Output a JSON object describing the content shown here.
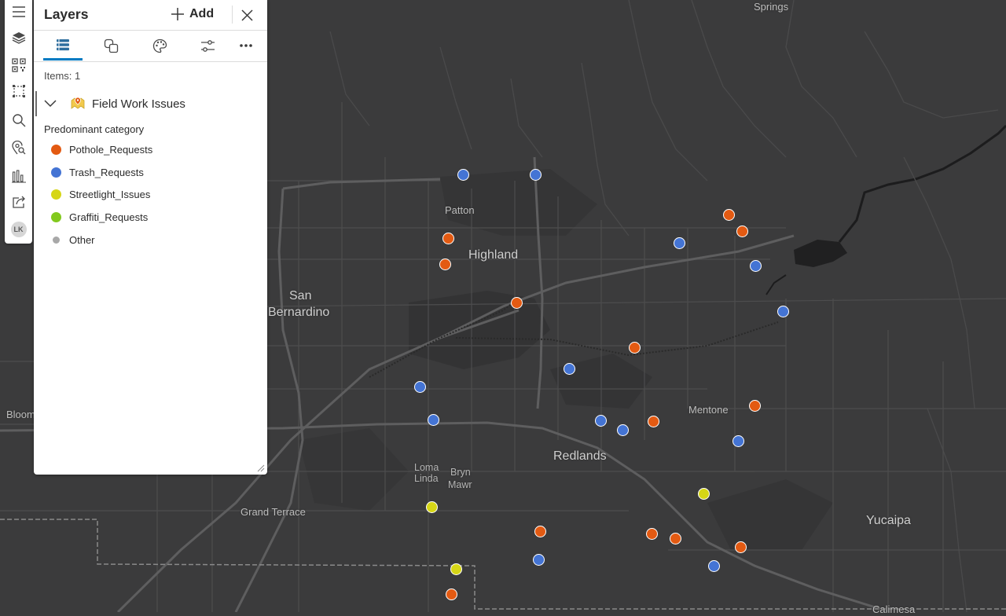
{
  "panel": {
    "title": "Layers",
    "add_label": "Add",
    "items_count": "Items: 1",
    "layer_name": "Field Work Issues",
    "legend_title": "Predominant category"
  },
  "action_bar": {
    "icons": [
      "menu-icon",
      "layers-icon",
      "qr-code-icon",
      "select-icon",
      "search-icon",
      "location-search-icon",
      "chart-icon",
      "share-icon"
    ],
    "user_initials": "LK"
  },
  "tabs": [
    "layer-list-tab",
    "features-tab",
    "styles-tab",
    "properties-tab",
    "more-tab"
  ],
  "legend": [
    {
      "label": "Pothole_Requests",
      "color": "#e35a12"
    },
    {
      "label": "Trash_Requests",
      "color": "#4474d4"
    },
    {
      "label": "Streetlight_Issues",
      "color": "#d6d616"
    },
    {
      "label": "Graffiti_Requests",
      "color": "#82c91e"
    },
    {
      "label": "Other",
      "color": "#a8a8a8"
    }
  ],
  "map": {
    "labels": {
      "springs": "Springs",
      "patton": "Patton",
      "highland": "Highland",
      "san": "San",
      "bernardino": "Bernardino",
      "bloom": "Bloom",
      "mentone": "Mentone",
      "redlands": "Redlands",
      "loma": "Loma",
      "linda": "Linda",
      "bryn": "Bryn",
      "mawr": "Mawr",
      "grand_terrace": "Grand Terrace",
      "yucaipa": "Yucaipa",
      "calimesa": "Calimesa"
    },
    "points": [
      {
        "cat": "Trash_Requests"
      },
      {
        "cat": "Trash_Requests"
      },
      {
        "cat": "Pothole_Requests"
      },
      {
        "cat": "Pothole_Requests"
      },
      {
        "cat": "Pothole_Requests"
      },
      {
        "cat": "Pothole_Requests"
      },
      {
        "cat": "Trash_Requests"
      },
      {
        "cat": "Trash_Requests"
      },
      {
        "cat": "Trash_Requests"
      },
      {
        "cat": "Pothole_Requests"
      },
      {
        "cat": "Trash_Requests"
      },
      {
        "cat": "Pothole_Requests"
      },
      {
        "cat": "Trash_Requests"
      },
      {
        "cat": "Trash_Requests"
      },
      {
        "cat": "Trash_Requests"
      },
      {
        "cat": "Trash_Requests"
      },
      {
        "cat": "Pothole_Requests"
      },
      {
        "cat": "Pothole_Requests"
      },
      {
        "cat": "Trash_Requests"
      },
      {
        "cat": "Streetlight_Issues"
      },
      {
        "cat": "Streetlight_Issues"
      },
      {
        "cat": "Pothole_Requests"
      },
      {
        "cat": "Pothole_Requests"
      },
      {
        "cat": "Pothole_Requests"
      },
      {
        "cat": "Pothole_Requests"
      },
      {
        "cat": "Trash_Requests"
      },
      {
        "cat": "Trash_Requests"
      },
      {
        "cat": "Streetlight_Issues"
      },
      {
        "cat": "Pothole_Requests"
      }
    ]
  }
}
